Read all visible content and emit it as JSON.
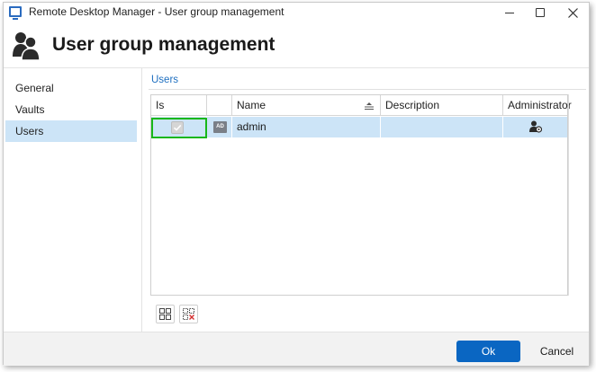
{
  "window": {
    "title": "Remote Desktop Manager - User group management"
  },
  "header": {
    "title": "User group management",
    "icon": "user-group-icon"
  },
  "sidebar": {
    "items": [
      {
        "label": "General",
        "active": false
      },
      {
        "label": "Vaults",
        "active": false
      },
      {
        "label": "Users",
        "active": true
      }
    ]
  },
  "main": {
    "section_label": "Users",
    "table": {
      "columns": [
        "Is member",
        "",
        "Name",
        "Description",
        "Administrator"
      ],
      "rows": [
        {
          "is_member": true,
          "badge": "AD",
          "name": "admin",
          "description": "",
          "administrator_icon": "admin-user-icon"
        }
      ]
    },
    "toolbar": {
      "select_all_icon": "select-all-icon",
      "deselect_all_icon": "deselect-all-icon"
    }
  },
  "footer": {
    "ok_label": "Ok",
    "cancel_label": "Cancel"
  },
  "colors": {
    "accent": "#0a66c2",
    "selection": "#cce4f7",
    "highlight": "#19b719",
    "section_label": "#1e6fc0"
  }
}
